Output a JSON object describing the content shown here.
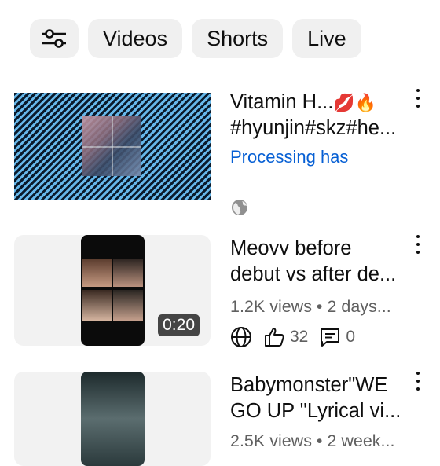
{
  "filters": {
    "chips": [
      {
        "label": "Videos"
      },
      {
        "label": "Shorts"
      },
      {
        "label": "Live"
      }
    ]
  },
  "videos": [
    {
      "title_line1": "Vitamin H...",
      "title_line1_emoji": "💋🔥",
      "title_line2": "#hyunjin#skz#he...",
      "status": "Processing has",
      "visibility_icon": "globe-icon"
    },
    {
      "title_line1": "Meovv before",
      "title_line2": "debut vs after de...",
      "meta": "1.2K views • 2 days...",
      "duration": "0:20",
      "likes": "32",
      "comments": "0",
      "visibility_icon": "globe-icon"
    },
    {
      "title_line1": "Babymonster\"WE",
      "title_line2": "GO UP \"Lyrical vi...",
      "meta": "2.5K views • 2 week..."
    }
  ],
  "colors": {
    "link_blue": "#065fd4",
    "chip_bg": "#f0f0f0",
    "meta_gray": "#606060"
  }
}
